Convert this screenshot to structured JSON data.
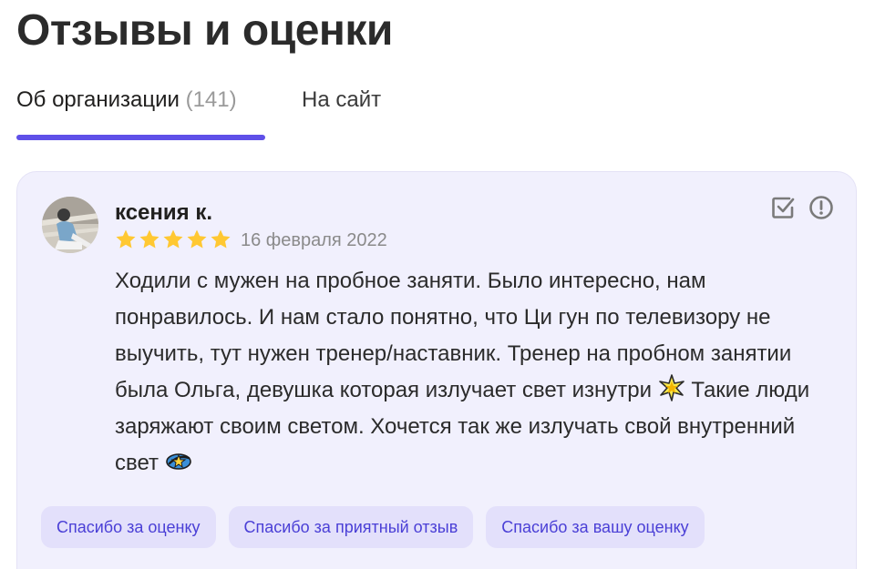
{
  "page": {
    "title": "Отзывы и оценки"
  },
  "tabs": [
    {
      "label": "Об организации",
      "count": "(141)",
      "active": true
    },
    {
      "label": "На сайт",
      "active": false
    }
  ],
  "review": {
    "author": "ксения к.",
    "rating": 5,
    "rating_max": 5,
    "date": "16 февраля 2022",
    "text_part1": "Ходили с мужен на пробное заняти. Было интересно, нам понравилось. И нам стало понятно, что Ци гун по телевизору не выучить, тут нужен тренер/наставник. Тренер на пробном занятии была Ольга, девушка которая излучает свет изнутри ",
    "emoji1": "sparkle-star-icon",
    "text_part2": " Такие люди заряжают своим светом. Хочется так же излучать свой внутренний свет ",
    "emoji2": "shooting-star-icon",
    "actions": [
      {
        "icon": "check-square-icon"
      },
      {
        "icon": "alert-circle-icon"
      }
    ],
    "reactions": [
      "Спасибо за оценку",
      "Спасибо за приятный отзыв",
      "Спасибо за вашу оценку"
    ]
  },
  "colors": {
    "accent": "#5f50e8",
    "card_bg": "#f1f0fd",
    "reaction_bg": "#e3e0fb",
    "reaction_text": "#4a3fd6",
    "star": "#ffc832",
    "muted_text": "#8a8a8a"
  }
}
